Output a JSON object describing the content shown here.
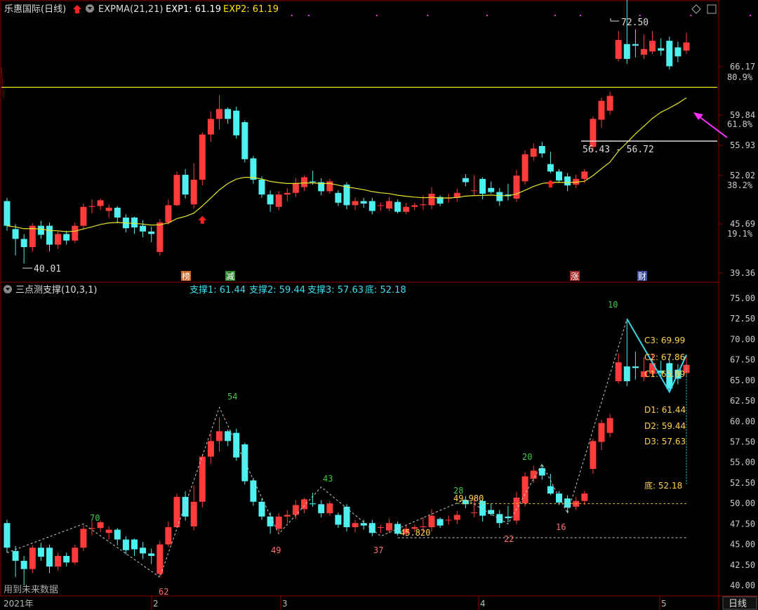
{
  "header": {
    "title": "乐惠国际(日线)",
    "indicator_name": "EXPMA(21,21)",
    "exp1_label": "EXP1: 61.19",
    "exp2_label": "EXP2: 61.19",
    "up_arrow_icon": "red-up-arrow-icon",
    "dropdown_icon": "circle-down-icon"
  },
  "toolbar_icons": [
    "diamond-icon",
    "square-icon"
  ],
  "lower_header": {
    "name": "三点测支撑(10,3,1)",
    "s1": "支撑1: 61.44",
    "s2": "支撑2: 59.44",
    "s3": "支撑3: 57.63",
    "bottom": "底: 52.18"
  },
  "colors": {
    "up": "#ff3b3b",
    "down": "#4ff0f0",
    "ema": "#e6e62a",
    "yellow_line": "#f0e010",
    "pattern": "#39d8e8",
    "label_yellow": "#ffd24a",
    "peak_green": "#3ec94a",
    "trough_red": "#ff7070",
    "magenta": "#ff30ff",
    "grid": "#8b0000"
  },
  "upper_axis": {
    "ticks": [
      "66.17",
      "59.84",
      "55.93",
      "52.02",
      "45.69",
      "39.36"
    ],
    "pct_ticks": [
      "80.9%",
      "61.8%",
      "38.2%",
      "19.1%"
    ]
  },
  "lower_axis": {
    "ticks": [
      "75.00",
      "72.50",
      "70.00",
      "67.50",
      "65.00",
      "62.50",
      "60.00",
      "57.50",
      "55.00",
      "52.50",
      "50.00",
      "47.50",
      "45.00",
      "42.50",
      "40.00"
    ]
  },
  "upper_annotations": {
    "high": "72.50",
    "low": "40.01",
    "range": "56.43 - 56.72"
  },
  "tags": [
    {
      "text": "榜",
      "color": "#c8682a"
    },
    {
      "text": "减",
      "color": "#2f8a2f"
    },
    {
      "text": "涨",
      "color": "#a02a2a"
    },
    {
      "text": "财",
      "color": "#3a4fa0"
    }
  ],
  "lower_annotations": {
    "pivot_labels": [
      "70",
      "54",
      "43",
      "28",
      "20",
      "10",
      "62",
      "49",
      "37",
      "22",
      "16"
    ],
    "level_labels": [
      "49.980",
      "45.820"
    ],
    "right_labels": [
      "C3: 69.99",
      "C2: 67.86",
      "C1: 65.89",
      "D1: 61.44",
      "D2: 59.44",
      "D3: 57.63",
      "底: 52.18"
    ],
    "footnote": "用到未来数据"
  },
  "x_axis": {
    "labels": [
      "2021年",
      "2",
      "3",
      "4",
      "5"
    ],
    "period": "日线"
  },
  "chart_data": {
    "type": "candlestick",
    "x": [
      "d1",
      "d2",
      "d3",
      "d4",
      "d5",
      "d6",
      "d7",
      "d8",
      "d9",
      "d10",
      "d11",
      "d12",
      "d13",
      "d14",
      "d15",
      "d16",
      "d17",
      "d18",
      "d19",
      "d20",
      "d21",
      "d22",
      "d23",
      "d24",
      "d25",
      "d26",
      "d27",
      "d28",
      "d29",
      "d30",
      "d31",
      "d32",
      "d33",
      "d34",
      "d35",
      "d36",
      "d37",
      "d38",
      "d39",
      "d40",
      "d41",
      "d42",
      "d43",
      "d44",
      "d45",
      "d46",
      "d47",
      "d48",
      "d49",
      "d50",
      "d51",
      "d52",
      "d53",
      "d54",
      "d55",
      "d56",
      "d57",
      "d58",
      "d59",
      "d60",
      "d61",
      "d62",
      "d63",
      "d64",
      "d65",
      "d66",
      "d67",
      "d68",
      "d69",
      "d70",
      "d71",
      "d72",
      "d73",
      "d74",
      "d75",
      "d76",
      "d77",
      "d78",
      "d79",
      "d80",
      "d81"
    ],
    "open": [
      47.6,
      44.2,
      43.0,
      42.0,
      44.6,
      44.6,
      42.3,
      43.6,
      42.8,
      44.6,
      46.9,
      47.0,
      46.4,
      46.8,
      45.6,
      45.6,
      44.6,
      43.9,
      41.4,
      45.0,
      47.1,
      50.8,
      47.2,
      50.2,
      55.7,
      57.6,
      58.8,
      58.6,
      57.2,
      52.8,
      50.2,
      48.4,
      46.9,
      48.4,
      48.6,
      49.3,
      50.0,
      49.9,
      48.8,
      48.6,
      49.6,
      47.1,
      47.6,
      47.6,
      47.1,
      46.7,
      47.5,
      46.3,
      46.9,
      47.1,
      47.1,
      48.1,
      48.0,
      48.0,
      50.4,
      48.9,
      50.3,
      49.2,
      48.7,
      48.4,
      47.9,
      50.0,
      53.0,
      54.3,
      52.1,
      51.2,
      50.6,
      49.6,
      50.3,
      54.2,
      57.5,
      58.6,
      64.9,
      66.7,
      66.7,
      65.4,
      65.8,
      66.2,
      67.1,
      66.3,
      65.9
    ],
    "close": [
      44.6,
      43.0,
      42.0,
      44.6,
      43.5,
      42.3,
      43.6,
      42.8,
      44.6,
      46.9,
      47.0,
      47.7,
      46.8,
      45.6,
      44.3,
      44.4,
      43.9,
      43.6,
      45.0,
      47.1,
      50.8,
      48.4,
      50.2,
      55.7,
      57.6,
      58.8,
      57.6,
      55.6,
      52.7,
      50.2,
      48.4,
      47.2,
      48.4,
      48.6,
      49.8,
      50.5,
      49.9,
      48.8,
      50.0,
      47.4,
      47.1,
      47.6,
      47.3,
      46.4,
      47.1,
      47.6,
      46.3,
      46.9,
      47.1,
      47.2,
      48.5,
      47.3,
      48.0,
      48.6,
      49.9,
      48.9,
      48.5,
      48.7,
      47.6,
      48.2,
      50.7,
      53.3,
      54.0,
      53.4,
      51.2,
      50.1,
      49.5,
      50.3,
      51.2,
      57.6,
      59.8,
      60.4,
      67.2,
      64.9,
      66.5,
      66.1,
      67.1,
      65.9,
      64.0,
      65.2,
      66.9
    ],
    "high": [
      48.0,
      44.8,
      43.6,
      44.9,
      45.2,
      45.0,
      44.0,
      44.0,
      45.0,
      47.3,
      47.8,
      47.9,
      47.2,
      47.0,
      46.0,
      45.7,
      45.3,
      44.5,
      45.4,
      47.8,
      51.2,
      51.5,
      52.2,
      56.0,
      58.5,
      60.5,
      59.0,
      59.1,
      57.4,
      53.1,
      50.6,
      48.9,
      48.8,
      49.2,
      50.4,
      50.7,
      51.3,
      50.4,
      50.3,
      48.9,
      49.9,
      48.0,
      48.0,
      48.0,
      47.4,
      48.1,
      47.8,
      47.4,
      47.4,
      48.3,
      49.3,
      48.3,
      48.5,
      49.1,
      50.9,
      50.7,
      50.5,
      50.0,
      49.2,
      49.7,
      51.4,
      53.8,
      54.6,
      54.8,
      53.6,
      51.5,
      51.0,
      50.8,
      51.5,
      57.9,
      60.2,
      60.9,
      68.3,
      72.5,
      68.5,
      67.8,
      68.3,
      67.4,
      67.6,
      67.0,
      68.1
    ],
    "low": [
      44.0,
      41.0,
      40.0,
      41.5,
      43.0,
      41.5,
      41.8,
      42.3,
      42.5,
      44.2,
      46.1,
      46.5,
      45.6,
      44.9,
      43.8,
      43.6,
      43.2,
      42.6,
      41.0,
      44.7,
      47.0,
      47.9,
      46.7,
      49.5,
      54.8,
      56.3,
      57.0,
      55.2,
      52.3,
      49.7,
      48.0,
      46.3,
      46.5,
      47.6,
      48.1,
      48.8,
      49.6,
      48.3,
      48.5,
      47.0,
      46.6,
      46.5,
      46.8,
      46.0,
      46.4,
      46.4,
      46.1,
      46.0,
      46.5,
      46.5,
      46.6,
      47.0,
      47.4,
      47.5,
      49.4,
      48.3,
      47.8,
      48.5,
      47.0,
      47.7,
      47.5,
      49.6,
      52.5,
      52.9,
      51.0,
      49.8,
      48.8,
      49.2,
      49.8,
      53.6,
      56.5,
      58.1,
      64.6,
      64.3,
      65.1,
      64.9,
      65.5,
      65.3,
      63.6,
      64.5,
      65.5
    ],
    "ema_exp1_last": 61.19,
    "ema_exp2_last": 61.19,
    "ema_period": 21,
    "horizontal_line": 61.44,
    "support_levels": {
      "support1": 61.44,
      "support2": 59.44,
      "support3": 57.63,
      "bottom": 52.18
    },
    "c_levels": {
      "C3": 69.99,
      "C2": 67.86,
      "C1": 65.89
    },
    "range_box": [
      56.43,
      56.72
    ],
    "extreme_high": 72.5,
    "extreme_low": 40.01,
    "upper_ylim": [
      39.36,
      69.5
    ],
    "lower_ylim": [
      40.0,
      75.0
    ],
    "dashed_levels": [
      49.98,
      45.82
    ],
    "zigzag_pivots": [
      {
        "i": 0,
        "v": 44.0
      },
      {
        "i": 9,
        "v": 47.5
      },
      {
        "i": 18,
        "v": 41.0
      },
      {
        "i": 25,
        "v": 61.7
      },
      {
        "i": 32,
        "v": 46.3
      },
      {
        "i": 37,
        "v": 52.0
      },
      {
        "i": 44,
        "v": 46.0
      },
      {
        "i": 54,
        "v": 50.5
      },
      {
        "i": 59,
        "v": 47.5
      },
      {
        "i": 63,
        "v": 54.8
      },
      {
        "i": 66,
        "v": 48.8
      },
      {
        "i": 73,
        "v": 72.5
      },
      {
        "i": 78,
        "v": 63.6
      },
      {
        "i": 80,
        "v": 68.1
      }
    ]
  }
}
